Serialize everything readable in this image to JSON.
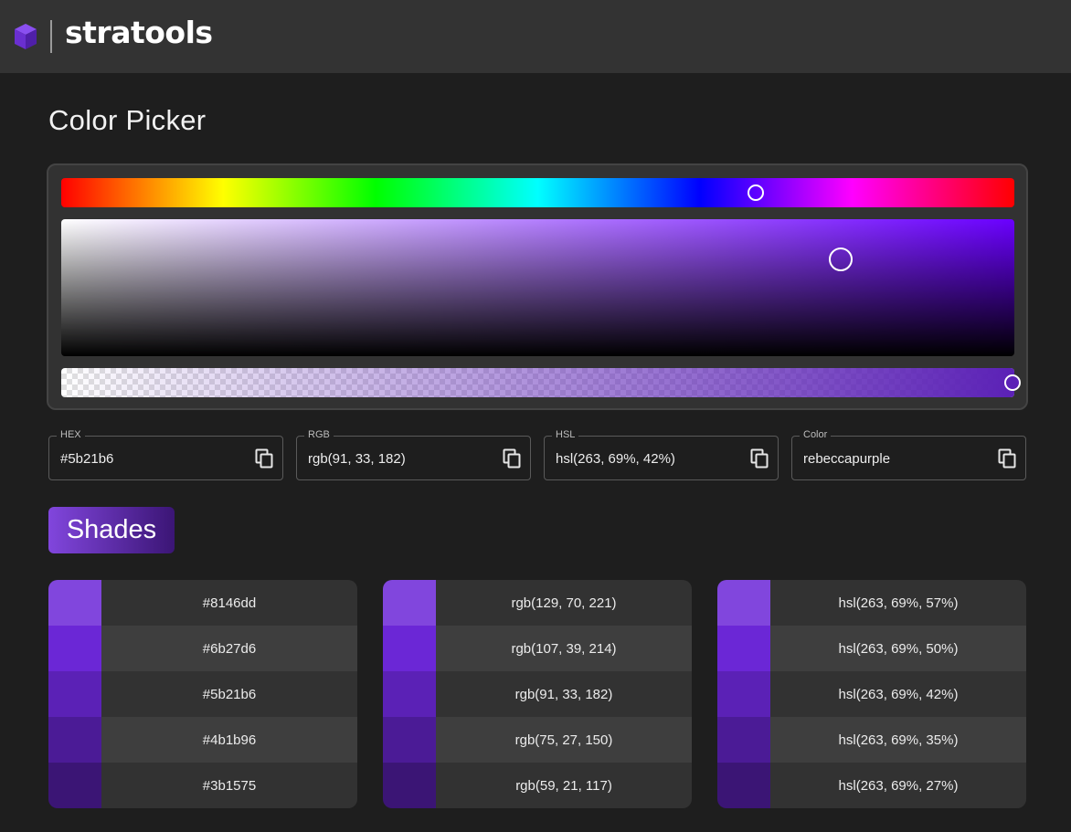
{
  "header": {
    "brand": "stratools",
    "logo_icon": "cube-icon",
    "logo_color": "#7b3fe0"
  },
  "page": {
    "title": "Color Picker"
  },
  "picker": {
    "hue_degrees": 263,
    "saturation": 0.69,
    "lightness": 0.42,
    "alpha": 1.0,
    "current_color": "#5b21b6"
  },
  "fields": [
    {
      "label": "HEX",
      "value": "#5b21b6",
      "icon": "copy-icon"
    },
    {
      "label": "RGB",
      "value": "rgb(91, 33, 182)",
      "icon": "copy-icon"
    },
    {
      "label": "HSL",
      "value": "hsl(263, 69%, 42%)",
      "icon": "copy-icon"
    },
    {
      "label": "Color",
      "value": "rebeccapurple",
      "icon": "copy-icon"
    }
  ],
  "shades_button": {
    "label": "Shades"
  },
  "shades": {
    "colors": [
      "#8146dd",
      "#6b27d6",
      "#5b21b6",
      "#4b1b96",
      "#3b1575"
    ],
    "hex": [
      "#8146dd",
      "#6b27d6",
      "#5b21b6",
      "#4b1b96",
      "#3b1575"
    ],
    "rgb": [
      "rgb(129, 70, 221)",
      "rgb(107, 39, 214)",
      "rgb(91, 33, 182)",
      "rgb(75, 27, 150)",
      "rgb(59, 21, 117)"
    ],
    "hsl": [
      "hsl(263, 69%, 57%)",
      "hsl(263, 69%, 50%)",
      "hsl(263, 69%, 42%)",
      "hsl(263, 69%, 35%)",
      "hsl(263, 69%, 27%)"
    ]
  }
}
